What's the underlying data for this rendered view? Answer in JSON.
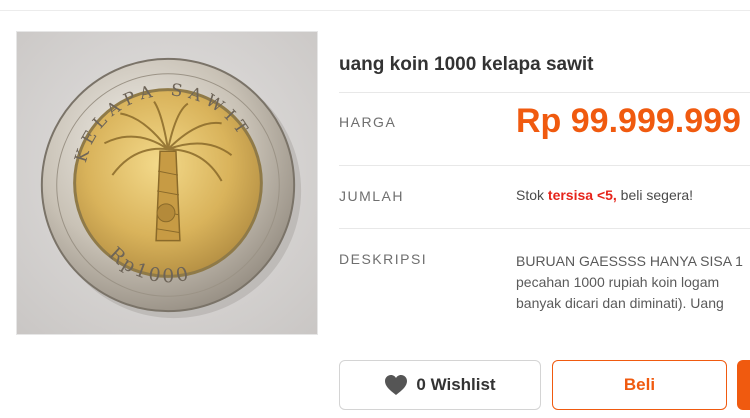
{
  "product": {
    "title": "uang koin 1000 kelapa sawit",
    "image": {
      "alt": "coin photo",
      "coin_top_text": "KELAPA SAWIT",
      "coin_denomination": "Rp1000"
    }
  },
  "details": {
    "price_label": "HARGA",
    "price_value": "Rp 99.999.999",
    "quantity_label": "JUMLAH",
    "stock_prefix": "Stok ",
    "stock_highlight": "tersisa <5,",
    "stock_suffix": " beli segera!",
    "description_label": "DESKRIPSI",
    "description_lines": [
      "BURUAN GAESSSS HANYA SISA 1",
      "pecahan 1000 rupiah koin logam",
      "banyak dicari dan diminati). Uang"
    ]
  },
  "actions": {
    "wishlist_icon": "heart-icon",
    "wishlist_label": "0 Wishlist",
    "buy_label": "Beli"
  },
  "colors": {
    "accent": "#f05a0f",
    "stock_alert": "#e6241b"
  }
}
